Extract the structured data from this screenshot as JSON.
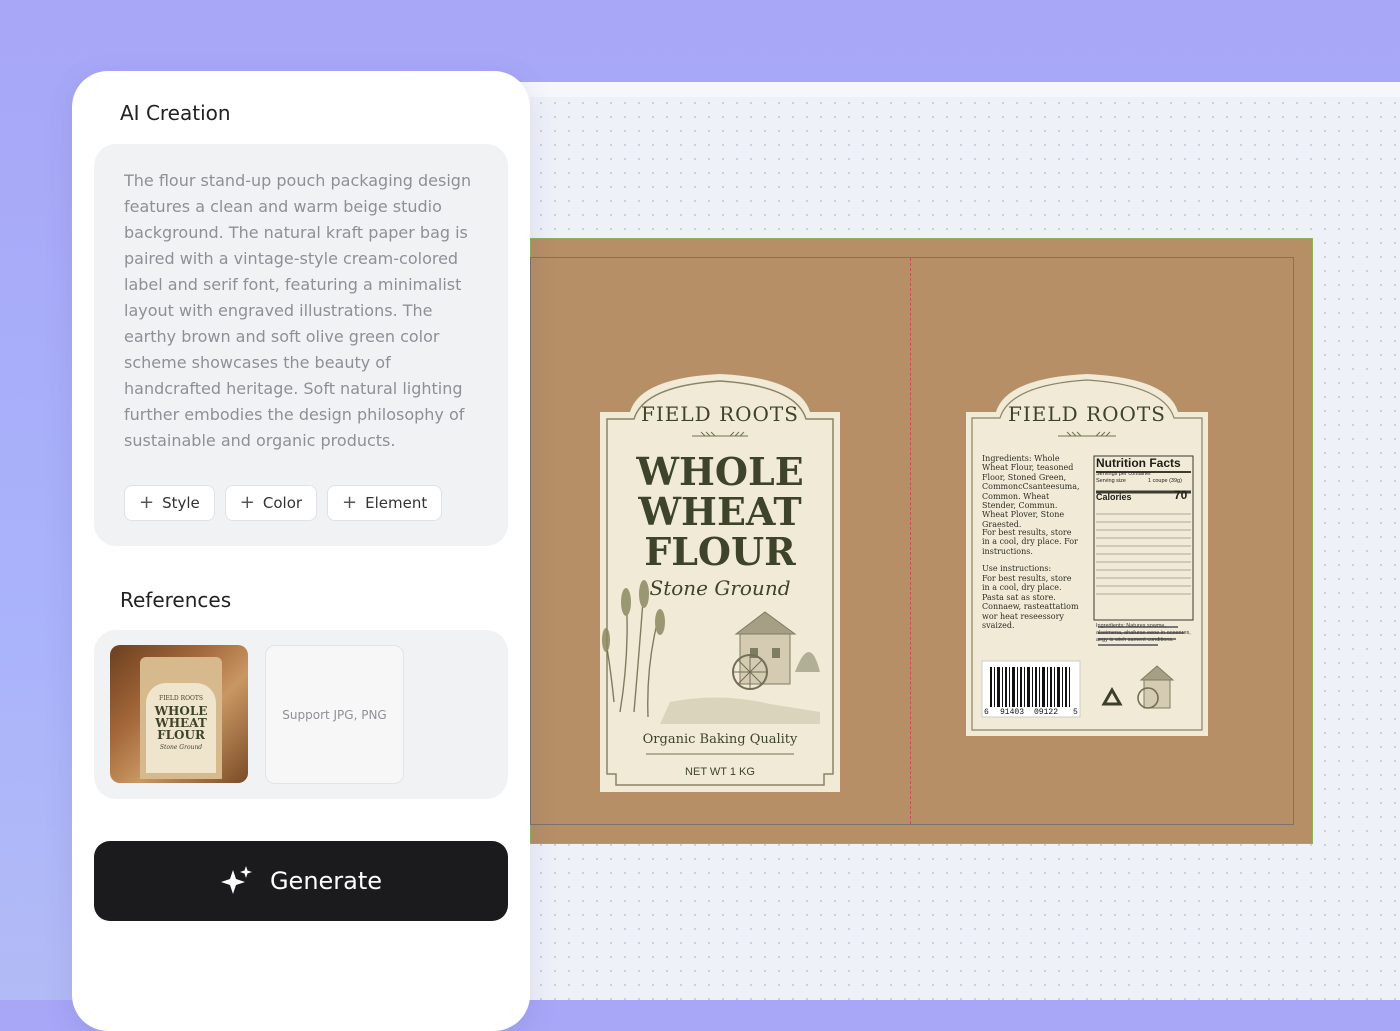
{
  "panel": {
    "title": "AI Creation",
    "prompt": "The flour stand-up pouch packaging design features a clean and warm beige studio background. The natural kraft paper bag is paired with a vintage-style cream-colored label and serif font, featuring a minimalist layout with engraved illustrations. The earthy brown and soft olive green color scheme showcases the beauty of handcrafted heritage. Soft natural lighting further embodies the design philosophy of sustainable and organic products.",
    "chips": [
      "Style",
      "Color",
      "Element"
    ],
    "references_title": "References",
    "upload_hint": "Support JPG, PNG",
    "generate_label": "Generate"
  },
  "reference_thumb": {
    "brand": "FIELD ROOTS",
    "line1": "WHOLE",
    "line2": "WHEAT",
    "line3": "FLOUR",
    "script": "Stone Ground"
  },
  "front_label": {
    "brand": "FIELD ROOTS",
    "line1": "WHOLE",
    "line2": "WHEAT",
    "line3": "FLOUR",
    "script": "Stone Ground",
    "tagline": "Organic Baking Quality",
    "net_wt": "NET WT 1 KG"
  },
  "back_label": {
    "brand": "FIELD ROOTS",
    "ingredients": "Ingredients: Whole Wheat Flour, teasoned Floor, Stoned Green, CommoncCsanteesuma, Common. Wheat Stender, Commun. Wheat Plover, Stone Graested.",
    "storage": "For best results, store in a cool, dry place. For instructions.",
    "use_title": "Use instructions:",
    "use_text": "For best results, store in a cool, dry place. Pasta sat as store. Connaew, rasteattatiom wor heat reseessory svaized.",
    "nutrition_title": "Nutrition Facts",
    "servings": "Servings per container",
    "serving_size_label": "Serving size",
    "serving_size_value": "1 coupe (39g)",
    "calories_label": "Calories",
    "calories_value": "70",
    "barcode_left": "6",
    "barcode_mid1": "91403",
    "barcode_mid2": "09122",
    "barcode_right": "5",
    "allergen": "Ingredients: Natures sowme, alseimena, ahafurse eeoe in oceenres, aegy is wieh sament conditions."
  },
  "colors": {
    "kraft": "#b78f66",
    "label_cream": "#f1ead6",
    "olive_text": "#3e4429",
    "fold_line": "#d2495b",
    "bleed_line": "#8eb25a",
    "generate_bg": "#1b1b1d"
  }
}
